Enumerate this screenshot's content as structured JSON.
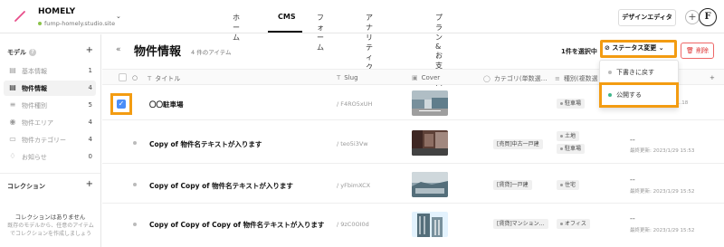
{
  "header": {
    "site_name": "HOMELY",
    "site_url": "fump-homely.studio.site",
    "nav": [
      "ホーム",
      "CMS",
      "フォーム",
      "アナリティクス",
      "プラン & お支払い"
    ],
    "designer_button": "デザインエディタ",
    "avatar_letter": "F"
  },
  "sidebar": {
    "models_heading": "モデル",
    "items": [
      {
        "label": "基本情報",
        "count": "1",
        "icon": "doc-icon"
      },
      {
        "label": "物件情報",
        "count": "4",
        "icon": "doc-icon"
      },
      {
        "label": "物件種別",
        "count": "5",
        "icon": "list-icon"
      },
      {
        "label": "物件エリア",
        "count": "4",
        "icon": "pin-icon"
      },
      {
        "label": "物件カテゴリー",
        "count": "4",
        "icon": "folder-icon"
      },
      {
        "label": "お知らせ",
        "count": "0",
        "icon": "bell-icon"
      }
    ],
    "collections_heading": "コレクション",
    "collections_empty_title": "コレクションはありません",
    "collections_empty_desc": "既存のモデルから、任意のアイテムでコレクションを作成しましょう"
  },
  "main": {
    "title": "物件情報",
    "count": "4 件のアイテム",
    "selected": "1件を選択中",
    "status_button": "ステータス変更",
    "delete_button": "削除",
    "columns": [
      "タイトル",
      "Slug",
      "Cover",
      "カテゴリ(単数選…",
      "種別(複数選"
    ],
    "rows": [
      {
        "title": "〇〇駐車場",
        "slug": "/ F4RO5xUH",
        "category": "",
        "types": [
          "駐車場"
        ],
        "dash": "",
        "updated": "...18"
      },
      {
        "title": "Copy of 物件名テキストが入ります",
        "slug": "/ teo5i3Vw",
        "category": "[売買]中古一戸建",
        "types": [
          "土地",
          "駐車場"
        ],
        "dash": "--",
        "updated": "最終更新: 2023/1/29 15:53"
      },
      {
        "title": "Copy of Copy of 物件名テキストが入ります",
        "slug": "/ yFbimXCX",
        "category": "[賃貸]一戸建",
        "types": [
          "住宅"
        ],
        "dash": "--",
        "updated": "最終更新: 2023/1/29 15:52"
      },
      {
        "title": "Copy of Copy of Copy of 物件名テキストが入ります",
        "slug": "/ 9zC0OI0d",
        "category": "[賃貸]マンション…",
        "types": [
          "オフィス"
        ],
        "dash": "--",
        "updated": "最終更新: 2023/1/29 15:52"
      }
    ]
  },
  "dropdown": {
    "items": [
      {
        "label": "下書きに戻す",
        "color": "#bbbbbb"
      },
      {
        "label": "公開する",
        "color": "#3fb68b"
      }
    ]
  },
  "colors": {
    "highlight": "#f39c12",
    "accent": "#4a8df8",
    "danger": "#dd3333"
  }
}
